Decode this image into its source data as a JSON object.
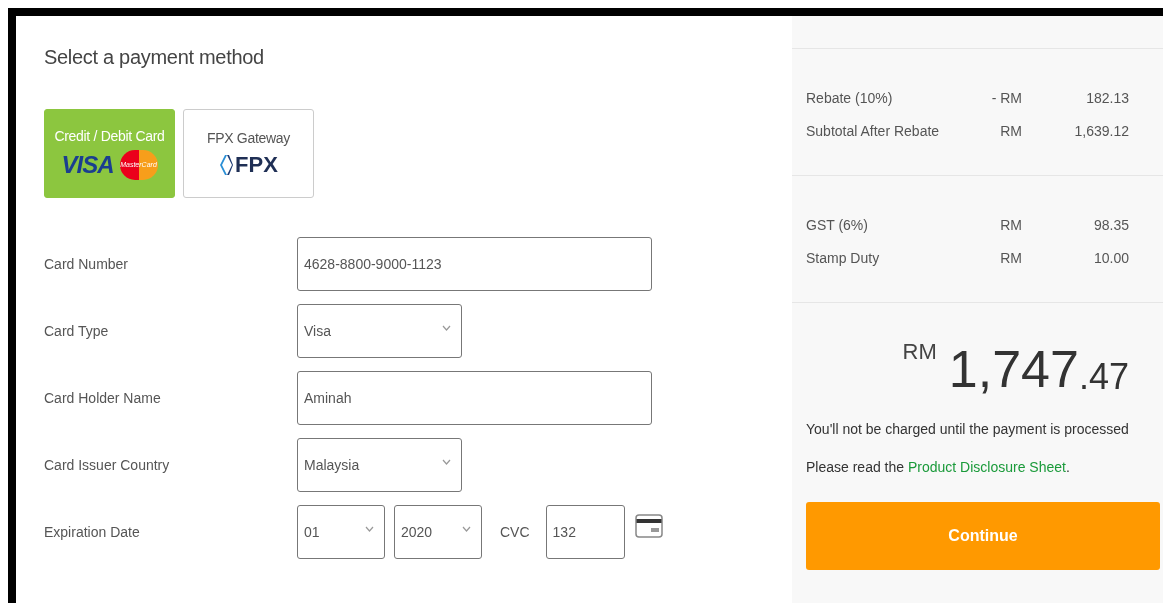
{
  "payment": {
    "title": "Select a payment method",
    "methods": [
      {
        "label": "Credit / Debit Card",
        "selected": true,
        "logos": [
          {
            "kind": "visa",
            "text": "VISA"
          },
          {
            "kind": "mastercard",
            "text": "MasterCard"
          }
        ]
      },
      {
        "label": "FPX Gateway",
        "selected": false,
        "logos": [
          {
            "kind": "fpx",
            "text": "FPX"
          }
        ]
      }
    ],
    "fields": [
      {
        "label": "Card Number",
        "kind": "text",
        "value": "4628-8800-9000-1123"
      },
      {
        "label": "Card Type",
        "kind": "select",
        "value": "Visa"
      },
      {
        "label": "Card Holder Name",
        "kind": "text",
        "value": "Aminah"
      },
      {
        "label": "Card Issuer Country",
        "kind": "select",
        "value": "Malaysia"
      },
      {
        "label": "Expiration Date",
        "kind": "expiry",
        "month": "01",
        "year": "2020",
        "cvc_label": "CVC",
        "cvc": "132"
      }
    ]
  },
  "summary": {
    "groups": [
      [
        {
          "label": "Rebate (10%)",
          "currency": "- RM",
          "amount": "182.13"
        },
        {
          "label": "Subtotal After Rebate",
          "currency": "RM",
          "amount": "1,639.12"
        }
      ],
      [
        {
          "label": "GST (6%)",
          "currency": "RM",
          "amount": "98.35"
        },
        {
          "label": "Stamp Duty",
          "currency": "RM",
          "amount": "10.00"
        }
      ]
    ],
    "total": {
      "currency": "RM",
      "whole": "1,747",
      "cents": ".47"
    },
    "note": "You'll not be charged until the payment is processed",
    "disclosure": {
      "text": "Please read the",
      "link": "Product Disclosure Sheet",
      "end": "."
    },
    "button": "Continue"
  }
}
